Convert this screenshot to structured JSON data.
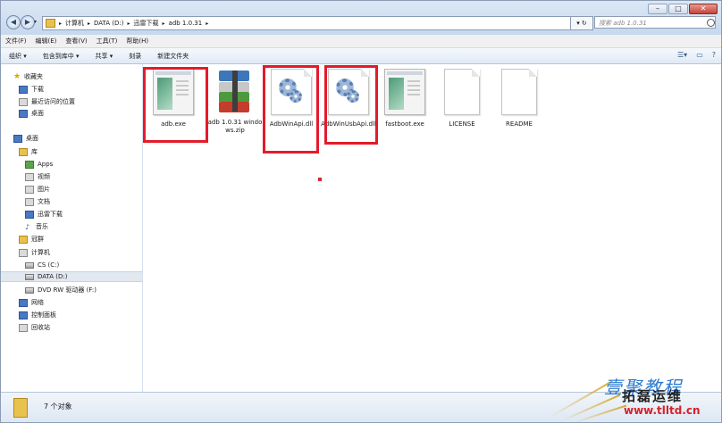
{
  "window": {
    "caption_buttons": [
      "–",
      "□",
      "✕"
    ]
  },
  "address_bar": {
    "crumbs": [
      "计算机",
      "DATA (D:)",
      "迅雷下载",
      "adb 1.0.31"
    ],
    "refresh_label": "▾ ↻",
    "search_placeholder": "搜索 adb 1.0.31"
  },
  "menu": [
    "文件(F)",
    "编辑(E)",
    "查看(V)",
    "工具(T)",
    "帮助(H)"
  ],
  "toolbar": {
    "items": [
      "组织 ▾",
      "包含到库中 ▾",
      "共享 ▾",
      "刻录",
      "新建文件夹"
    ]
  },
  "nav": {
    "favorites": "收藏夹",
    "downloads": "下载",
    "recent": "最近访问的位置",
    "desktop_fav": "桌面",
    "desktop": "桌面",
    "libraries": "库",
    "apps": "Apps",
    "videos": "视频",
    "pictures": "图片",
    "documents": "文档",
    "thunder": "迅雷下载",
    "music": "音乐",
    "homegroup": "冠群",
    "computer": "计算机",
    "drive_c": "CS (C:)",
    "drive_d": "DATA (D:)",
    "drive_f": "DVD RW 驱动器 (F:)",
    "network": "网络",
    "control_panel": "控制面板",
    "recycle_bin": "回收站"
  },
  "files": [
    {
      "name": "adb.exe",
      "icon": "exe-icon",
      "highlighted": true
    },
    {
      "name": "adb 1.0.31 windows.zip",
      "icon": "winrar-archive-icon",
      "highlighted": false
    },
    {
      "name": "AdbWinApi.dll",
      "icon": "dll-gear-icon",
      "highlighted": true
    },
    {
      "name": "AdbWinUsbApi.dll",
      "icon": "dll-gear-icon",
      "highlighted": true
    },
    {
      "name": "fastboot.exe",
      "icon": "exe-icon",
      "highlighted": false
    },
    {
      "name": "LICENSE",
      "icon": "blank-file-icon",
      "highlighted": false
    },
    {
      "name": "README",
      "icon": "blank-file-icon",
      "highlighted": false
    }
  ],
  "status": {
    "count_text": "7 个对象"
  },
  "watermark": {
    "line1": "壹聚教程",
    "line2": "拓磊运维",
    "url": "www.tlltd.cn"
  },
  "colors": {
    "highlight_red": "#e41a2b",
    "selection": "#e2e8f0",
    "watermark_blue": "#2b7bd0",
    "watermark_red": "#d8202a"
  }
}
